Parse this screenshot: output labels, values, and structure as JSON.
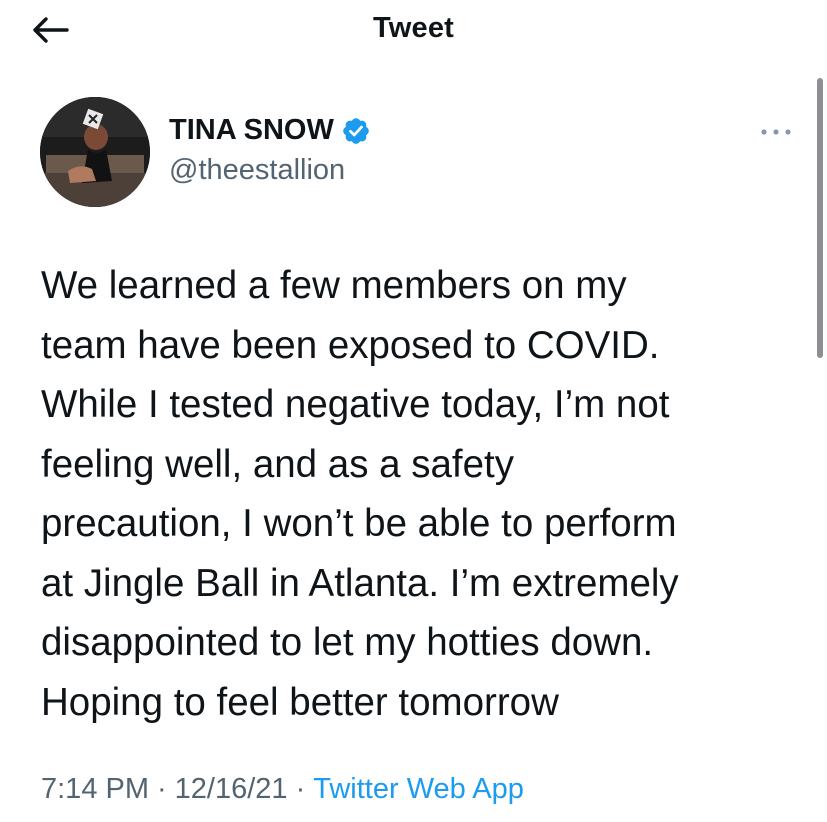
{
  "header": {
    "title": "Tweet"
  },
  "author": {
    "name": "TINA SNOW",
    "handle": "@theestallion",
    "verified": true
  },
  "tweet": {
    "text": "We learned a few members on my\nteam have been exposed to COVID.\nWhile I tested negative today, I’m not\nfeeling well, and as a safety\nprecaution, I won’t be able to perform\nat Jingle Ball in Atlanta. I’m extremely\ndisappointed to let my hotties down.\nHoping to feel better tomorrow"
  },
  "meta": {
    "time": "7:14 PM",
    "separator": "·",
    "date": "12/16/21",
    "source": "Twitter Web App"
  },
  "colors": {
    "accent": "#1d9bf0",
    "text": "#0f1419",
    "secondary": "#536471"
  },
  "icons": {
    "back": "arrow-left-icon",
    "verified": "verified-badge-icon",
    "more": "more-horizontal-icon"
  }
}
